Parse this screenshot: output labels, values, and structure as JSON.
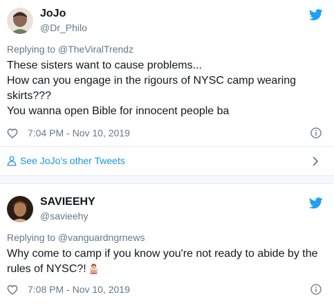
{
  "brand_color": "#1da1f2",
  "link_color": "#1b95e0",
  "tweets": [
    {
      "display_name": "JoJo",
      "handle": "@Dr_Philo",
      "replying_prefix": "Replying to",
      "replying_to": "@TheViralTrendz",
      "lines": [
        "These sisters want to cause problems...",
        "How can you engage in the rigours of NYSC camp wearing",
        "skirts???",
        "You wanna open Bible for innocent people ba"
      ],
      "timestamp": "7:04 PM - Nov 10, 2019",
      "icons": [
        "heart-icon",
        "info-icon",
        "twitter-bird-icon"
      ]
    },
    {
      "display_name": "SAVIEEHY",
      "handle": "@savieehy",
      "replying_prefix": "Replying to",
      "replying_to": "@vanguardngrnews",
      "lines": [
        "Why come to camp if you know you're not ready to abide by the",
        "rules of NYSC?!"
      ],
      "emoji": "woman-gesturing-no-emoji",
      "timestamp": "7:08 PM - Nov 10, 2019",
      "icons": [
        "heart-icon",
        "info-icon",
        "twitter-bird-icon"
      ]
    }
  ],
  "see_other": {
    "label": "See JoJo's other Tweets",
    "icon": "person-icon",
    "chevron": "chevron-right-icon"
  }
}
